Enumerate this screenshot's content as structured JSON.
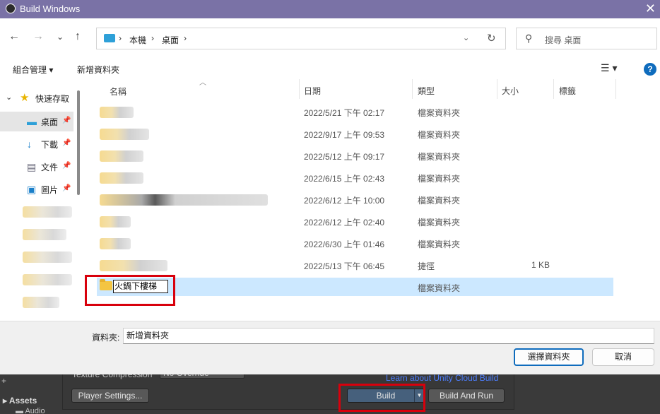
{
  "window": {
    "title": "Build Windows",
    "close": "✕"
  },
  "nav": {
    "back": "←",
    "forward": "→",
    "recent": "⌄",
    "up": "↑",
    "breadcrumb": [
      "本機",
      "桌面"
    ],
    "search_placeholder": "搜尋 桌面"
  },
  "commands": {
    "organize": "組合管理 ▾",
    "new_folder": "新增資料夾",
    "view": "☰ ▾",
    "help": "?"
  },
  "sidebar": {
    "quick_access": "快速存取",
    "items": [
      {
        "label": "桌面",
        "icon": "desktop-icon"
      },
      {
        "label": "下載",
        "icon": "download-icon"
      },
      {
        "label": "文件",
        "icon": "document-icon"
      },
      {
        "label": "圖片",
        "icon": "picture-icon"
      }
    ]
  },
  "columns": {
    "name": "名稱",
    "date": "日期",
    "type": "類型",
    "size": "大小",
    "tags": "標籤"
  },
  "files": [
    {
      "date": "2022/5/21 下午 02:17",
      "type": "檔案資料夾",
      "size": ""
    },
    {
      "date": "2022/9/17 上午 09:53",
      "type": "檔案資料夾",
      "size": ""
    },
    {
      "date": "2022/5/12 上午 09:17",
      "type": "檔案資料夾",
      "size": ""
    },
    {
      "date": "2022/6/15 上午 02:43",
      "type": "檔案資料夾",
      "size": ""
    },
    {
      "date": "2022/6/12 上午 10:00",
      "type": "檔案資料夾",
      "size": ""
    },
    {
      "date": "2022/6/12 上午 02:40",
      "type": "檔案資料夾",
      "size": ""
    },
    {
      "date": "2022/6/30 上午 01:46",
      "type": "檔案資料夾",
      "size": ""
    },
    {
      "date": "2022/5/13 下午 06:45",
      "type": "捷徑",
      "size": "1 KB"
    }
  ],
  "new_folder_row": {
    "name": "火鍋下樓梯",
    "type": "檔案資料夾"
  },
  "footer": {
    "folder_label": "資料夾:",
    "folder_value": "新增資料夾",
    "select_button": "選擇資料夾",
    "cancel_button": "取消"
  },
  "unity": {
    "texture_compression_label": "Texture Compression",
    "texture_compression_value": "No Override",
    "cloud_link": "Learn about Unity Cloud Build",
    "player_settings": "Player Settings...",
    "build": "Build",
    "build_and_run": "Build And Run",
    "assets": "Assets",
    "audio": "Audio"
  },
  "colors": {
    "titlebar": "#7a72a6",
    "selection": "#cce8ff",
    "highlight_box": "#d8000c",
    "accent": "#0f6cbd"
  }
}
